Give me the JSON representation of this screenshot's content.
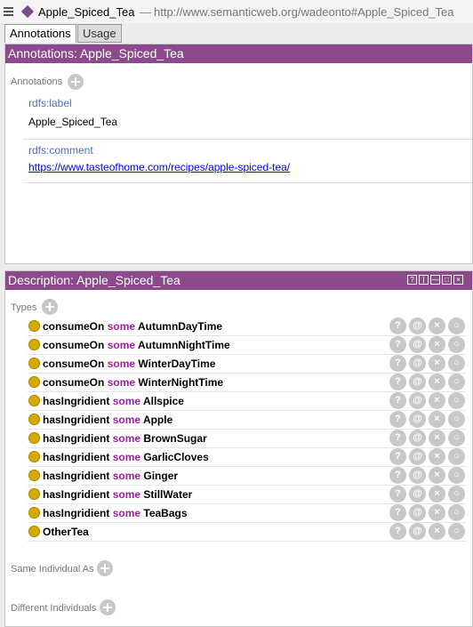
{
  "title": {
    "entity": "Apple_Spiced_Tea",
    "separator": "—",
    "iri": "http://www.semanticweb.org/wadeonto#Apple_Spiced_Tea"
  },
  "tabs": [
    {
      "label": "Annotations",
      "active": true
    },
    {
      "label": "Usage",
      "active": false
    }
  ],
  "annotations_panel": {
    "header": "Annotations: Apple_Spiced_Tea",
    "section_label": "Annotations",
    "items": [
      {
        "property": "rdfs:label",
        "value": "Apple_Spiced_Tea"
      },
      {
        "property": "rdfs:comment",
        "value": "https://www.tasteofhome.com/recipes/apple-spiced-tea/"
      }
    ]
  },
  "description_panel": {
    "header": "Description: Apple_Spiced_Tea",
    "header_icons": [
      "?",
      "|",
      "—",
      "□",
      "×"
    ],
    "types_label": "Types",
    "types": [
      {
        "property": "consumeOn",
        "keyword": "some",
        "filler": "AutumnDayTime"
      },
      {
        "property": "consumeOn",
        "keyword": "some",
        "filler": "AutumnNightTime"
      },
      {
        "property": "consumeOn",
        "keyword": "some",
        "filler": "WinterDayTime"
      },
      {
        "property": "consumeOn",
        "keyword": "some",
        "filler": "WinterNightTime"
      },
      {
        "property": "hasIngridient",
        "keyword": "some",
        "filler": "Allspice"
      },
      {
        "property": "hasIngridient",
        "keyword": "some",
        "filler": "Apple"
      },
      {
        "property": "hasIngridient",
        "keyword": "some",
        "filler": "BrownSugar"
      },
      {
        "property": "hasIngridient",
        "keyword": "some",
        "filler": "GarlicCloves"
      },
      {
        "property": "hasIngridient",
        "keyword": "some",
        "filler": "Ginger"
      },
      {
        "property": "hasIngridient",
        "keyword": "some",
        "filler": "StillWater"
      },
      {
        "property": "hasIngridient",
        "keyword": "some",
        "filler": "TeaBags"
      },
      {
        "property": "OtherTea",
        "keyword": "",
        "filler": ""
      }
    ],
    "row_action_labels": [
      "?",
      "@",
      "×",
      "○"
    ],
    "same_individual_label": "Same Individual As",
    "different_individuals_label": "Different Individuals"
  },
  "colors": {
    "header_bg": "#8c4a8c",
    "keyword": "#a020a0",
    "annotation_key": "#4a6fb8",
    "bullet": "#d4a900"
  }
}
